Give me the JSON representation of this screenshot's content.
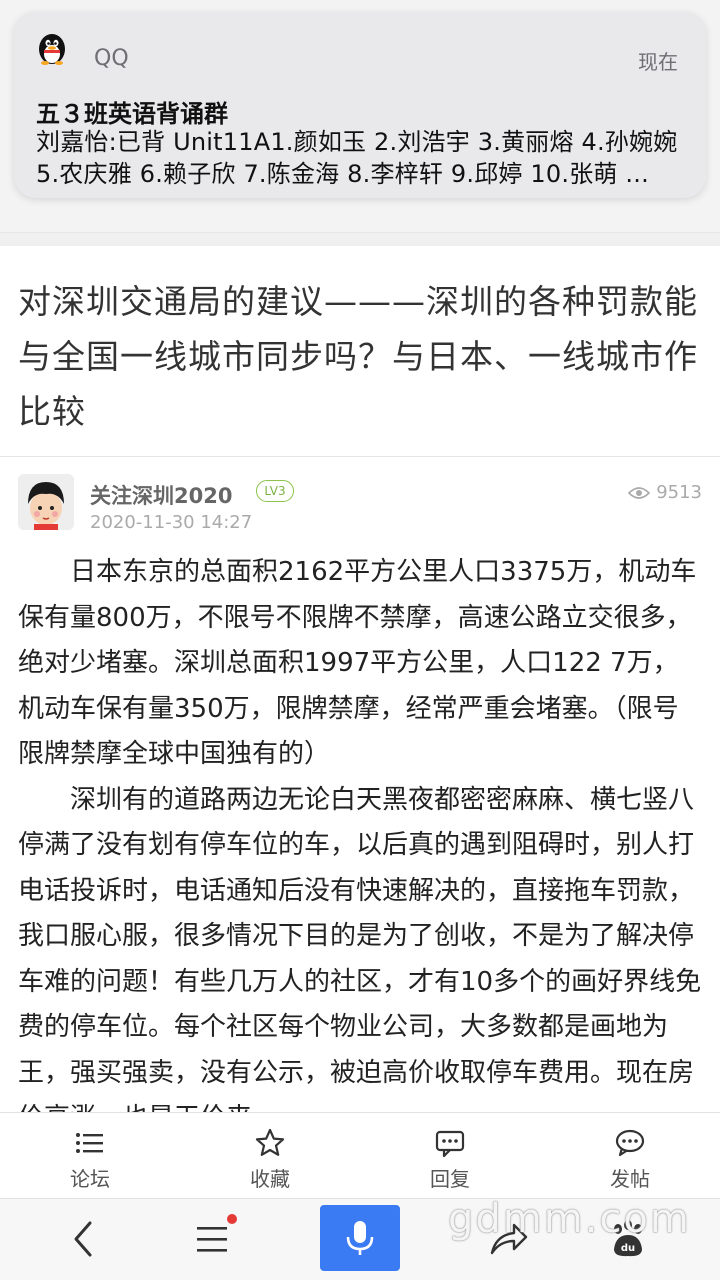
{
  "notification": {
    "app_name": "QQ",
    "time": "现在",
    "title": "五３班英语背诵群",
    "body": "刘嘉怡:已背 Unit11A1.颜如玉 2.刘浩宇 3.黄丽熔 4.孙婉婉 5.农庆雅 6.赖子欣 7.陈金海 8.李梓轩 9.邱婷 10.张萌 ..."
  },
  "article": {
    "title": "对深圳交通局的建议———深圳的各种罚款能与全国一线城市同步吗？与日本、一线城市作比较",
    "author": "关注深圳2020",
    "level_badge": "LV3",
    "date": "2020-11-30 14:27",
    "views": "9513",
    "paragraphs": [
      "　　日本东京的总面积2162平方公里人口3375万，机动车保有量800万，不限号不限牌不禁摩，高速公路立交很多，绝对少堵塞。深圳总面积1997平方公里，人口122 7万，机动车保有量350万，限牌禁摩，经常严重会堵塞。（限号限牌禁摩全球中国独有的）",
      "　　深圳有的道路两边无论白天黑夜都密密麻麻、横七竖八停满了没有划有停车位的车，以后真的遇到阻碍时，别人打电话投诉时，电话通知后没有快速解决的，直接拖车罚款，我口服心服，很多情况下目的是为了创收，不是为了解决停车难的问题！有些几万人的社区，才有10多个的画好界线免费的停车位。每个社区每个物业公司，大多数都是画地为王，强买强卖，没有公示，被迫高价收取停车费用。现在房价高涨，也是天价来"
    ]
  },
  "tabbar": {
    "forum": "论坛",
    "favorite": "收藏",
    "reply": "回复",
    "post": "发帖"
  },
  "watermark": "gdmm.com",
  "colors": {
    "accent_blue": "#3a7af2",
    "level_green": "#7cb342",
    "dot_red": "#e53935"
  }
}
